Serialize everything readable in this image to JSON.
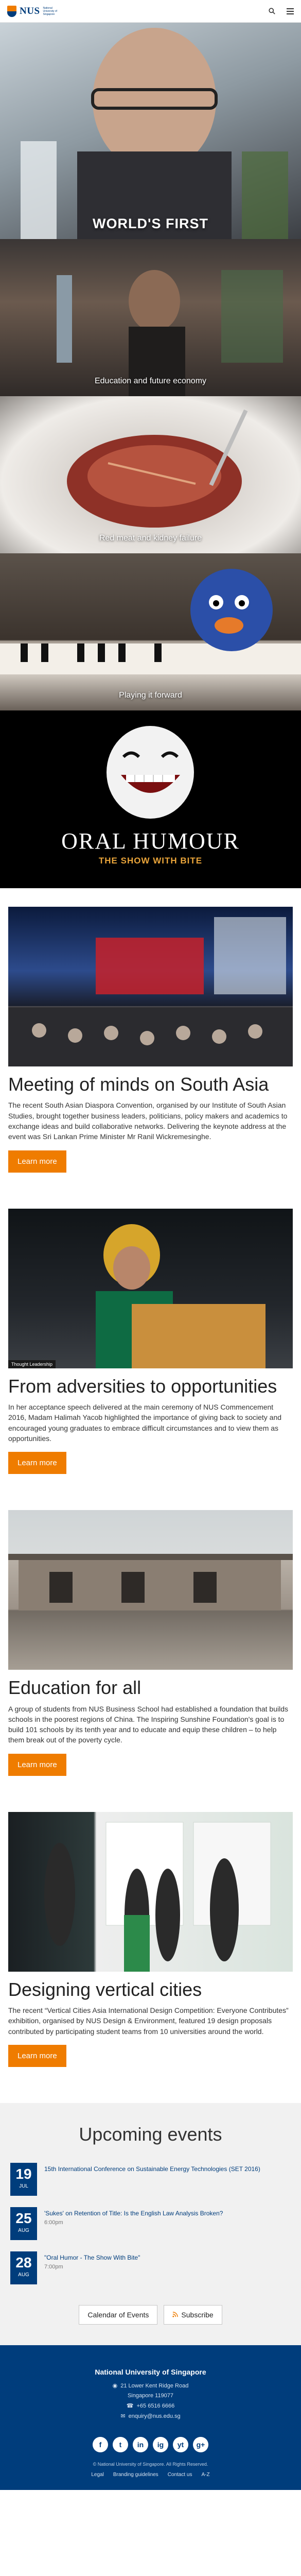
{
  "header": {
    "logo_text": "NUS",
    "logo_sub": "National University of Singapore"
  },
  "hero": {
    "caption": "WORLD'S FIRST"
  },
  "tiles": [
    {
      "caption": "Education and future economy"
    },
    {
      "caption": "Red meat and kidney failure"
    },
    {
      "caption": "Playing it forward"
    }
  ],
  "promo": {
    "title": "ORAL HUMOUR",
    "subtitle": "THE SHOW WITH BITE"
  },
  "articles": [
    {
      "title": "Meeting of minds on South Asia",
      "body": "The recent South Asian Diaspora Convention, organised by our Institute of South Asian Studies, brought together business leaders, politicians, policy makers and academics to exchange ideas and build collaborative networks. Delivering the keynote address at the event was Sri Lankan Prime Minister Mr Ranil Wickremesinghe.",
      "button": "Learn more"
    },
    {
      "badge": "Thought Leadership",
      "title": "From adversities to opportunities",
      "body": "In her acceptance speech delivered at the main ceremony of NUS Commencement 2016, Madam Halimah Yacob highlighted the importance of giving back to society and encouraged young graduates to embrace difficult circumstances and to view them as opportunities.",
      "button": "Learn more"
    },
    {
      "title": "Education for all",
      "body": "A group of students from NUS Business School had established a foundation that builds schools in the poorest regions of China. The Inspiring Sunshine Foundation's goal is to build 101 schools by its tenth year and to educate and equip these children – to help them break out of the poverty cycle.",
      "button": "Learn more"
    },
    {
      "title": "Designing vertical cities",
      "body": "The recent “Vertical Cities Asia International Design Competition: Everyone Contributes” exhibition, organised by NUS Design & Environment, featured 19 design proposals contributed by participating student teams from 10 universities around the world.",
      "button": "Learn more"
    }
  ],
  "events": {
    "title": "Upcoming events",
    "items": [
      {
        "day": "19",
        "month": "JUL",
        "title": "15th International Conference on Sustainable Energy Technologies (SET 2016)",
        "time": ""
      },
      {
        "day": "25",
        "month": "AUG",
        "title": "'Sukes' on Retention of Title: Is the English Law Analysis Broken?",
        "time": "6:00pm"
      },
      {
        "day": "28",
        "month": "AUG",
        "title": "\"Oral Humor - The Show With Bite\"",
        "time": "7:00pm"
      }
    ],
    "calendar_button": "Calendar of Events",
    "subscribe_button": "Subscribe"
  },
  "footer": {
    "org": "National University of Singapore",
    "address1": "21 Lower Kent Ridge Road",
    "address2": "Singapore 119077",
    "phone": "+65 6516 6666",
    "email": "enquiry@nus.edu.sg",
    "socials": [
      "f",
      "t",
      "in",
      "ig",
      "yt",
      "g+"
    ],
    "copyright": "© National University of Singapore. All Rights Reserved.",
    "links": [
      "Legal",
      "Branding guidelines",
      "Contact us",
      "A-Z"
    ]
  }
}
